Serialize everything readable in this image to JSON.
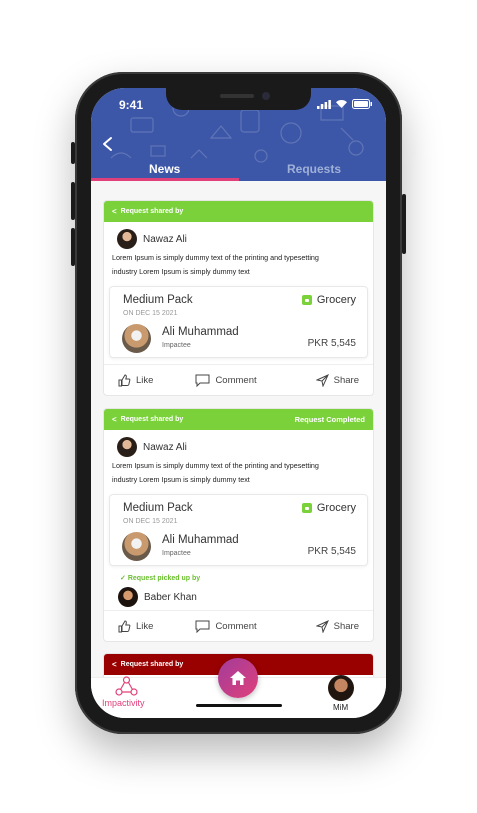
{
  "status": {
    "time": "9:41"
  },
  "tabs": [
    {
      "label": "News",
      "active": true
    },
    {
      "label": "Requests",
      "active": false
    }
  ],
  "colors": {
    "header": "#3d57a8",
    "accent": "#e0407a",
    "green": "#7ad13a",
    "red": "#990000"
  },
  "posts": [
    {
      "shared_label": "Request shared by",
      "status_label": "",
      "author": "Nawaz Ali",
      "text_line1": "Lorem Ipsum is simply dummy text of the printing and typesetting",
      "text_line2": "industry Lorem Ipsum is simply dummy text",
      "pack": {
        "title": "Medium Pack",
        "date": "ON DEC 15 2021",
        "tag": "Grocery",
        "impactee_name": "Ali Muhammad",
        "impactee_role": "Impactee",
        "price": "PKR 5,545"
      },
      "actions": {
        "like": "Like",
        "comment": "Comment",
        "share": "Share"
      }
    },
    {
      "shared_label": "Request shared by",
      "status_label": "Request Completed",
      "author": "Nawaz Ali",
      "text_line1": "Lorem Ipsum is simply dummy text of the printing and typesetting",
      "text_line2": "industry Lorem Ipsum is simply dummy text",
      "pack": {
        "title": "Medium Pack",
        "date": "ON DEC 15 2021",
        "tag": "Grocery",
        "impactee_name": "Ali Muhammad",
        "impactee_role": "Impactee",
        "price": "PKR 5,545"
      },
      "picked_label": "Request picked up by",
      "picker": "Baber Khan",
      "actions": {
        "like": "Like",
        "comment": "Comment",
        "share": "Share"
      }
    },
    {
      "shared_label": "Request shared by"
    }
  ],
  "bottom_nav": {
    "left_label": "Impactivity",
    "right_label": "MiM",
    "home_icon": "home-icon"
  }
}
